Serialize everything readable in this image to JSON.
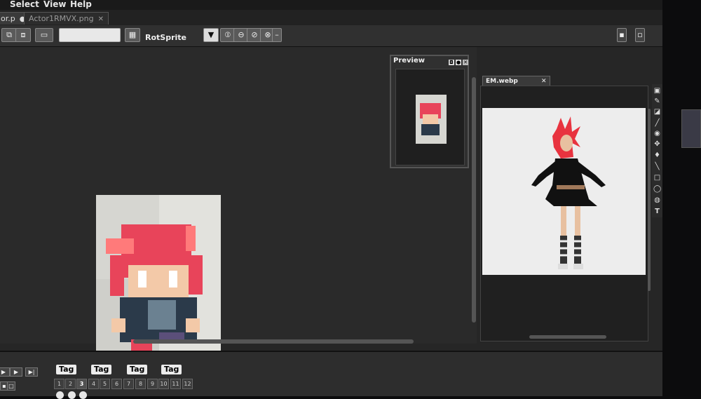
{
  "menu": {
    "items": [
      "Select",
      "View",
      "Help"
    ]
  },
  "tabs": [
    {
      "label": "or.p",
      "active": true
    },
    {
      "label": "Actor1RMVX.png",
      "active": false
    }
  ],
  "toolbar": {
    "mode_select": "RotSprite"
  },
  "preview": {
    "title": "Preview"
  },
  "reference": {
    "tab_label": "EM.webp",
    "close": "✕"
  },
  "timeline": {
    "tags": [
      "Tag",
      "Tag",
      "Tag",
      "Tag"
    ],
    "frames": [
      "1",
      "2",
      "3",
      "4",
      "5",
      "6",
      "7",
      "8",
      "9",
      "10",
      "11",
      "12"
    ],
    "current_frame": "3"
  },
  "tools": [
    "select-icon",
    "pencil-icon",
    "eraser-icon",
    "brush-icon",
    "fill-icon",
    "move-icon",
    "dropper-icon",
    "line-icon",
    "rect-icon",
    "ellipse-icon",
    "shading-icon",
    "text-icon"
  ],
  "tool_glyphs": [
    "▣",
    "✎",
    "◪",
    "╱",
    "◉",
    "✥",
    "♦",
    "╲",
    "□",
    "◯",
    "◍",
    "T"
  ],
  "colors": {
    "accent_hair": "#e8445a",
    "hair_light": "#ff7a7a",
    "skin": "#f3c9a8",
    "outfit": "#2b3a4a"
  }
}
